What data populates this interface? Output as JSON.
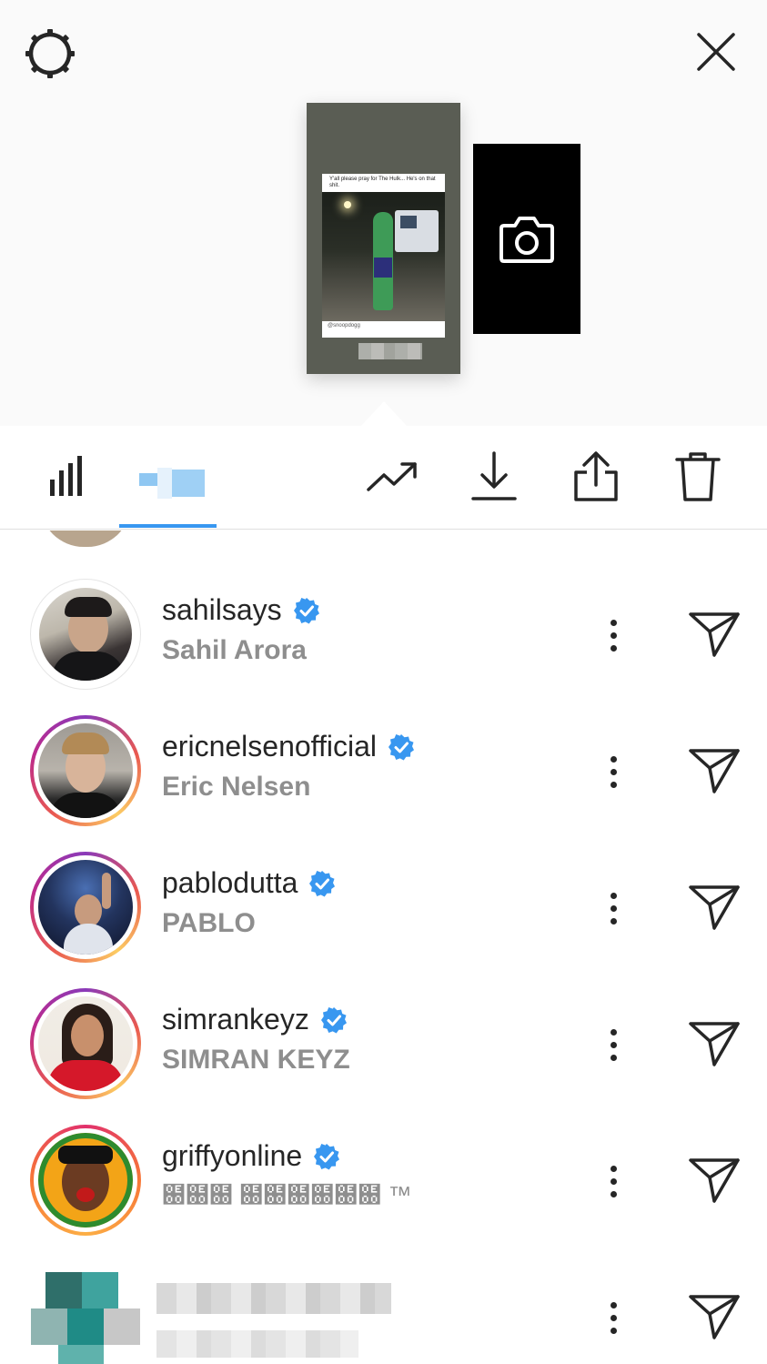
{
  "story_preview": {
    "post_caption": "Y'all please pray for The Hulk... He's on that shit.",
    "post_credit": "@snoopdogg"
  },
  "viewers": [
    {
      "username": "sahilsays",
      "full_name": "Sahil Arora",
      "verified": true,
      "story_ring": false
    },
    {
      "username": "ericnelsenofficial",
      "full_name": "Eric Nelsen",
      "verified": true,
      "story_ring": true
    },
    {
      "username": "pablodutta",
      "full_name": "PABLO",
      "verified": true,
      "story_ring": true
    },
    {
      "username": "simrankeyz",
      "full_name": "SIMRAN KEYZ",
      "verified": true,
      "story_ring": true
    },
    {
      "username": "griffyonline",
      "full_name": "฀฀฀ ฀฀฀฀฀฀ ™",
      "verified": true,
      "story_ring": true
    }
  ],
  "colors": {
    "accent_blue": "#3897f0",
    "verified_blue": "#3897f0",
    "secondary_text": "#8e8e8e"
  },
  "icons": {
    "settings": "gear-icon",
    "close": "close-icon",
    "insights": "bar-chart-icon",
    "promote": "trending-icon",
    "save": "download-icon",
    "share": "share-icon",
    "delete": "trash-icon",
    "camera": "camera-icon",
    "more": "more-vertical-icon",
    "send": "paper-plane-icon"
  }
}
